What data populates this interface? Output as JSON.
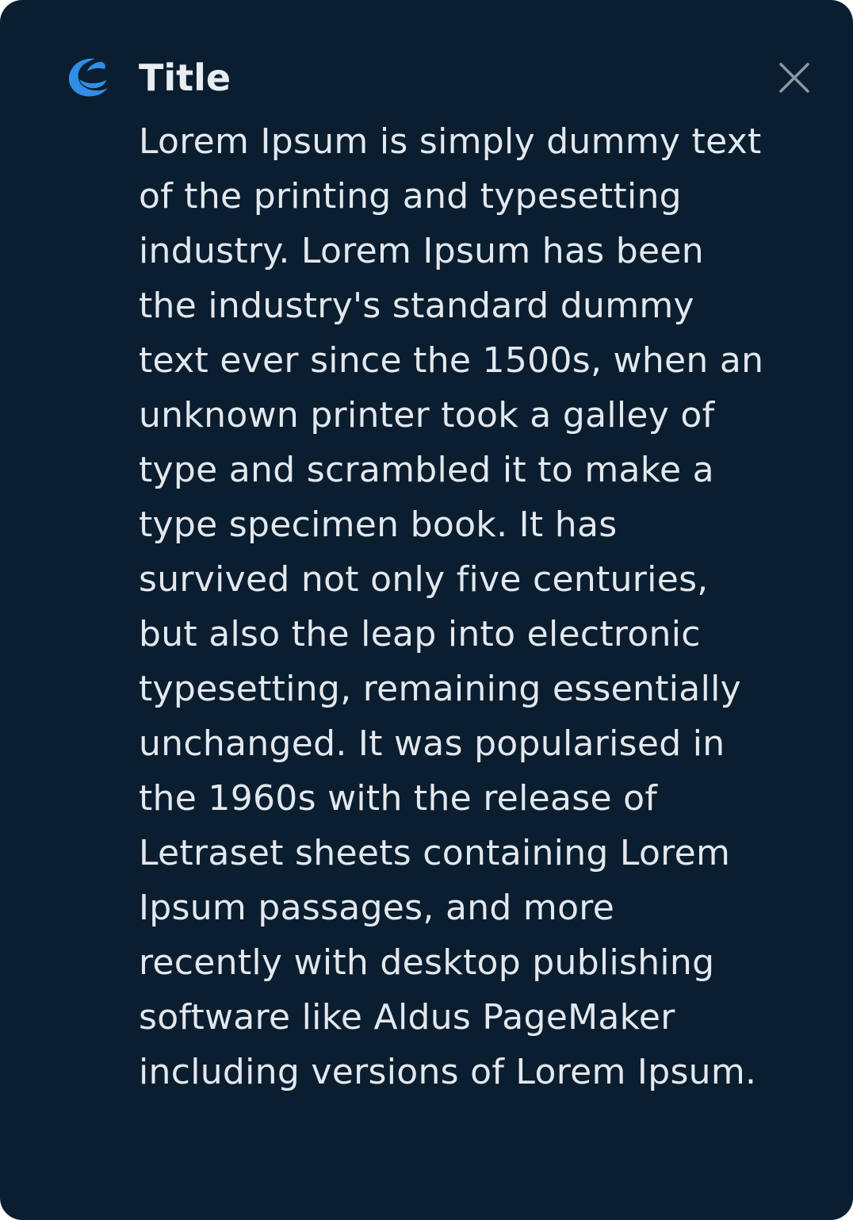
{
  "dialog": {
    "title": "Title",
    "body": "Lorem Ipsum is simply dummy text of the printing and typesetting industry. Lorem Ipsum has been the industry's standard dummy text ever since the 1500s, when an unknown printer took a galley of type and scrambled it to make a type specimen book. It has survived not only five centuries, but also the leap into electronic typesetting, remaining essentially unchanged. It was popularised in the 1960s with the release of Letraset sheets containing Lorem Ipsum passages, and more recently with desktop publishing software like Aldus PageMaker including versions of Lorem Ipsum.",
    "logo_icon": "crescent-logo-icon",
    "close_icon": "close-icon"
  },
  "colors": {
    "background": "#0b1e2f",
    "accent": "#2f8fe6",
    "text": "#e3e8ee",
    "close_icon": "#8a96a3"
  }
}
